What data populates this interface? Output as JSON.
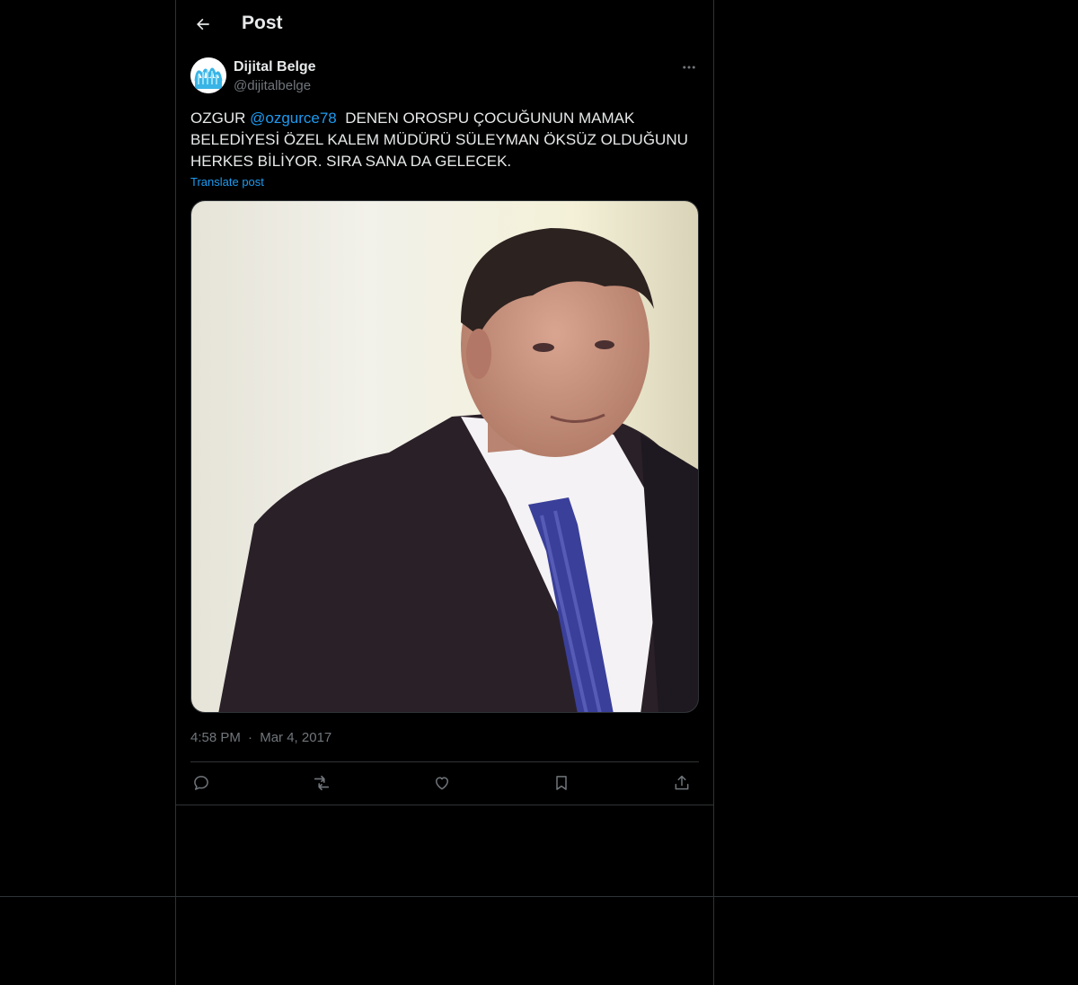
{
  "header": {
    "title": "Post",
    "back_icon": "arrow-left-icon"
  },
  "author": {
    "name": "Dijital Belge",
    "handle": "@dijitalbelge",
    "avatar_icon": "blue-waves-logo"
  },
  "post": {
    "text_before": "OZGUR ",
    "mention": "@ozgurce78",
    "text_after": "  DENEN OROSPU ÇOCUĞUNUN MAMAK BELEDİYESİ ÖZEL KALEM MÜDÜRÜ SÜLEYMAN ÖKSÜZ OLDUĞUNU HERKES BİLİYOR. SIRA SANA DA GELECEK.",
    "translate_label": "Translate post",
    "media_alt": "photo of a man in a dark suit and blue striped tie",
    "time": "4:58 PM",
    "separator": "·",
    "date": "Mar 4, 2017"
  },
  "actions": [
    {
      "icon": "reply-icon"
    },
    {
      "icon": "repost-icon"
    },
    {
      "icon": "like-icon"
    },
    {
      "icon": "bookmark-icon"
    },
    {
      "icon": "share-icon"
    }
  ],
  "colors": {
    "background": "#000000",
    "text": "#e7e9ea",
    "secondary": "#71767b",
    "accent": "#1d9bf0",
    "border": "#2f3336"
  }
}
